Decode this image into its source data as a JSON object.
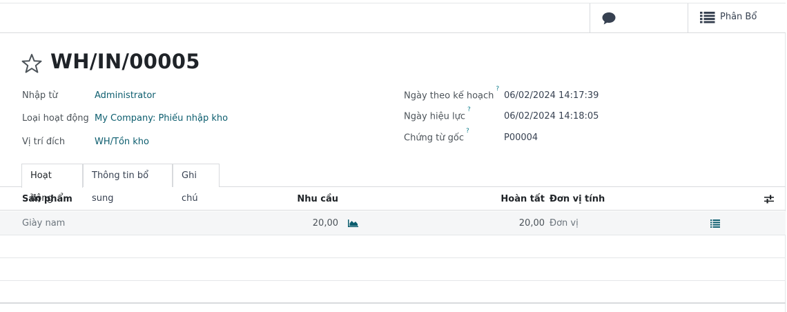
{
  "topbar": {
    "chatter_icon": "speech-bubble-icon",
    "allocation_icon": "list-icon",
    "allocation_label": "Phân Bổ"
  },
  "record": {
    "favorite_icon": "star-outline-icon",
    "name": "WH/IN/00005"
  },
  "fields_left": [
    {
      "label": "Nhập từ",
      "value": "Administrator"
    },
    {
      "label": "Loại hoạt động",
      "value": "My Company: Phiếu nhập kho"
    },
    {
      "label": "Vị trí đích",
      "value": "WH/Tồn kho"
    }
  ],
  "fields_right": [
    {
      "label": "Ngày theo kế hoạch",
      "help": "?",
      "value": "06/02/2024 14:17:39"
    },
    {
      "label": "Ngày hiệu lực",
      "help": "?",
      "value": "06/02/2024 14:18:05"
    },
    {
      "label": "Chứng từ gốc",
      "help": "?",
      "value": "P00004"
    }
  ],
  "tabs": [
    {
      "label": "Hoạt động",
      "active": true
    },
    {
      "label": "Thông tin bổ sung",
      "active": false
    },
    {
      "label": "Ghi chú",
      "active": false
    }
  ],
  "table": {
    "headers": {
      "product": "Sản phẩm",
      "demand": "Nhu cầu",
      "done": "Hoàn tất",
      "uom": "Đơn vị tính"
    },
    "settings_icon": "sliders-icon",
    "rows": [
      {
        "product": "Giày nam",
        "demand": "20,00",
        "forecast_icon": "area-chart-icon",
        "done": "20,00",
        "uom": "Đơn vị",
        "details_icon": "list-icon"
      }
    ]
  },
  "colors": {
    "accent": "#0c5d6e",
    "help": "#0e7d8c",
    "border": "#d8dadd"
  }
}
